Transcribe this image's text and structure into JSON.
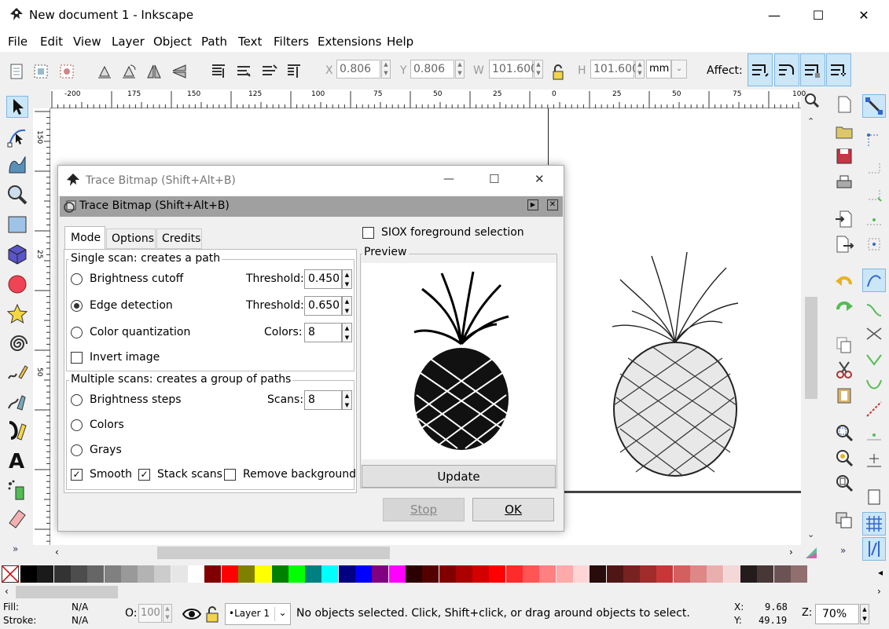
{
  "window": {
    "title": "New document 1 - Inkscape",
    "minimize": "—",
    "maximize": "☐",
    "close": "✕"
  },
  "menu": [
    "File",
    "Edit",
    "View",
    "Layer",
    "Object",
    "Path",
    "Text",
    "Filters",
    "Extensions",
    "Help"
  ],
  "toolbar": {
    "x_label": "X",
    "x_value": "0.806",
    "y_label": "Y",
    "y_value": "0.806",
    "w_label": "W",
    "w_value": "101.600",
    "h_label": "H",
    "h_value": "101.600",
    "unit": "mm",
    "affect_label": "Affect:"
  },
  "ruler": {
    "h_labels": [
      "-200",
      "175",
      "150",
      "125",
      "100",
      "75",
      "50",
      "25",
      "0",
      "25",
      "50",
      "75",
      "100"
    ],
    "v_labels": [
      "150",
      "25",
      "50"
    ]
  },
  "dialog": {
    "title": "Trace Bitmap (Shift+Alt+B)",
    "panel_title": "Trace Bitmap (Shift+Alt+B)",
    "tabs": [
      "Mode",
      "Options",
      "Credits"
    ],
    "siox": "SIOX foreground selection",
    "preview_label": "Preview",
    "single_scan": {
      "title": "Single scan: creates a path",
      "brightness": "Brightness cutoff",
      "threshold1_label": "Threshold:",
      "threshold1": "0.450",
      "edge": "Edge detection",
      "threshold2_label": "Threshold:",
      "threshold2": "0.650",
      "color_quant": "Color quantization",
      "colors_label": "Colors:",
      "colors": "8",
      "invert": "Invert image"
    },
    "multi_scan": {
      "title": "Multiple scans: creates a group of paths",
      "brightness_steps": "Brightness steps",
      "scans_label": "Scans:",
      "scans": "8",
      "colors": "Colors",
      "grays": "Grays",
      "smooth": "Smooth",
      "stack": "Stack scans",
      "remove_bg": "Remove background"
    },
    "update": "Update",
    "stop": "Stop",
    "ok": "OK"
  },
  "palette": [
    "#000000",
    "#1a1a1a",
    "#333333",
    "#4d4d4d",
    "#666666",
    "#808080",
    "#999999",
    "#b3b3b3",
    "#cccccc",
    "#e6e6e6",
    "#ffffff",
    "#800000",
    "#ff0000",
    "#808000",
    "#ffff00",
    "#008000",
    "#00ff00",
    "#008080",
    "#00ffff",
    "#000080",
    "#0000ff",
    "#800080",
    "#ff00ff",
    "#2b0000",
    "#550000",
    "#800000",
    "#aa0000",
    "#d40000",
    "#ff0000",
    "#ff2a2a",
    "#ff5555",
    "#ff8080",
    "#ffaaaa",
    "#ffd5d5",
    "#280b0b",
    "#501616",
    "#782121",
    "#a02c2c",
    "#c83737",
    "#d35f5f",
    "#de8787",
    "#e9afaf",
    "#f4d7d7",
    "#241c1c",
    "#483737",
    "#6c5353",
    "#916f6f"
  ],
  "status": {
    "fill_label": "Fill:",
    "fill_value": "N/A",
    "stroke_label": "Stroke:",
    "stroke_value": "N/A",
    "opacity_label": "O:",
    "opacity_value": "100",
    "layer": "•Layer 1",
    "message": "No objects selected. Click, Shift+click, or drag around objects to select.",
    "x_label": "X:",
    "x_value": "9.68",
    "y_label": "Y:",
    "y_value": "49.19",
    "z_label": "Z:",
    "zoom": "70%"
  }
}
